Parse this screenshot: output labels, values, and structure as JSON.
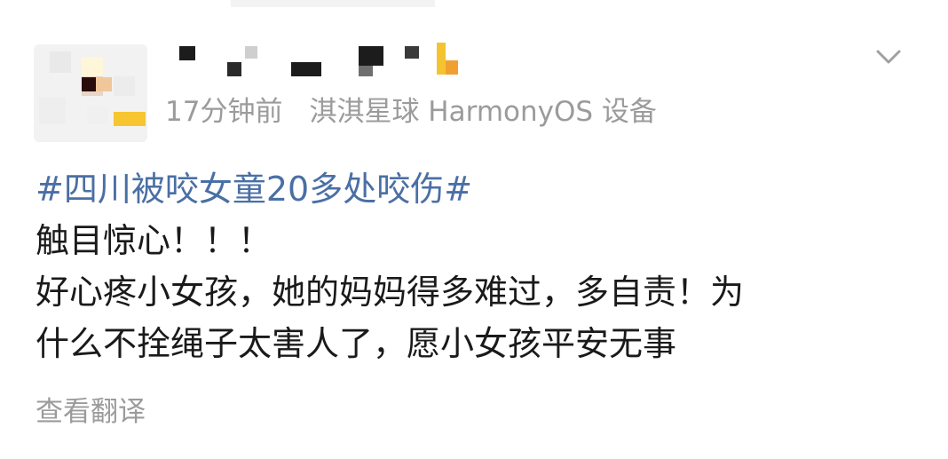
{
  "post": {
    "time": "17分钟前",
    "source": "淇淇星球 HarmonyOS 设备",
    "topic": "#四川被咬女童20多处咬伤#",
    "lines": [
      "触目惊心！！！",
      "好心疼小女孩，她的妈妈得多难过，多自责！为",
      "什么不拴绳子太害人了，愿小女孩平安无事"
    ],
    "translate_label": "查看翻译"
  },
  "icons": {
    "expand": "chevron-down-icon"
  },
  "colors": {
    "topic": "#4a6fa5",
    "meta": "#9b9b9b",
    "text": "#1a1a1a"
  }
}
